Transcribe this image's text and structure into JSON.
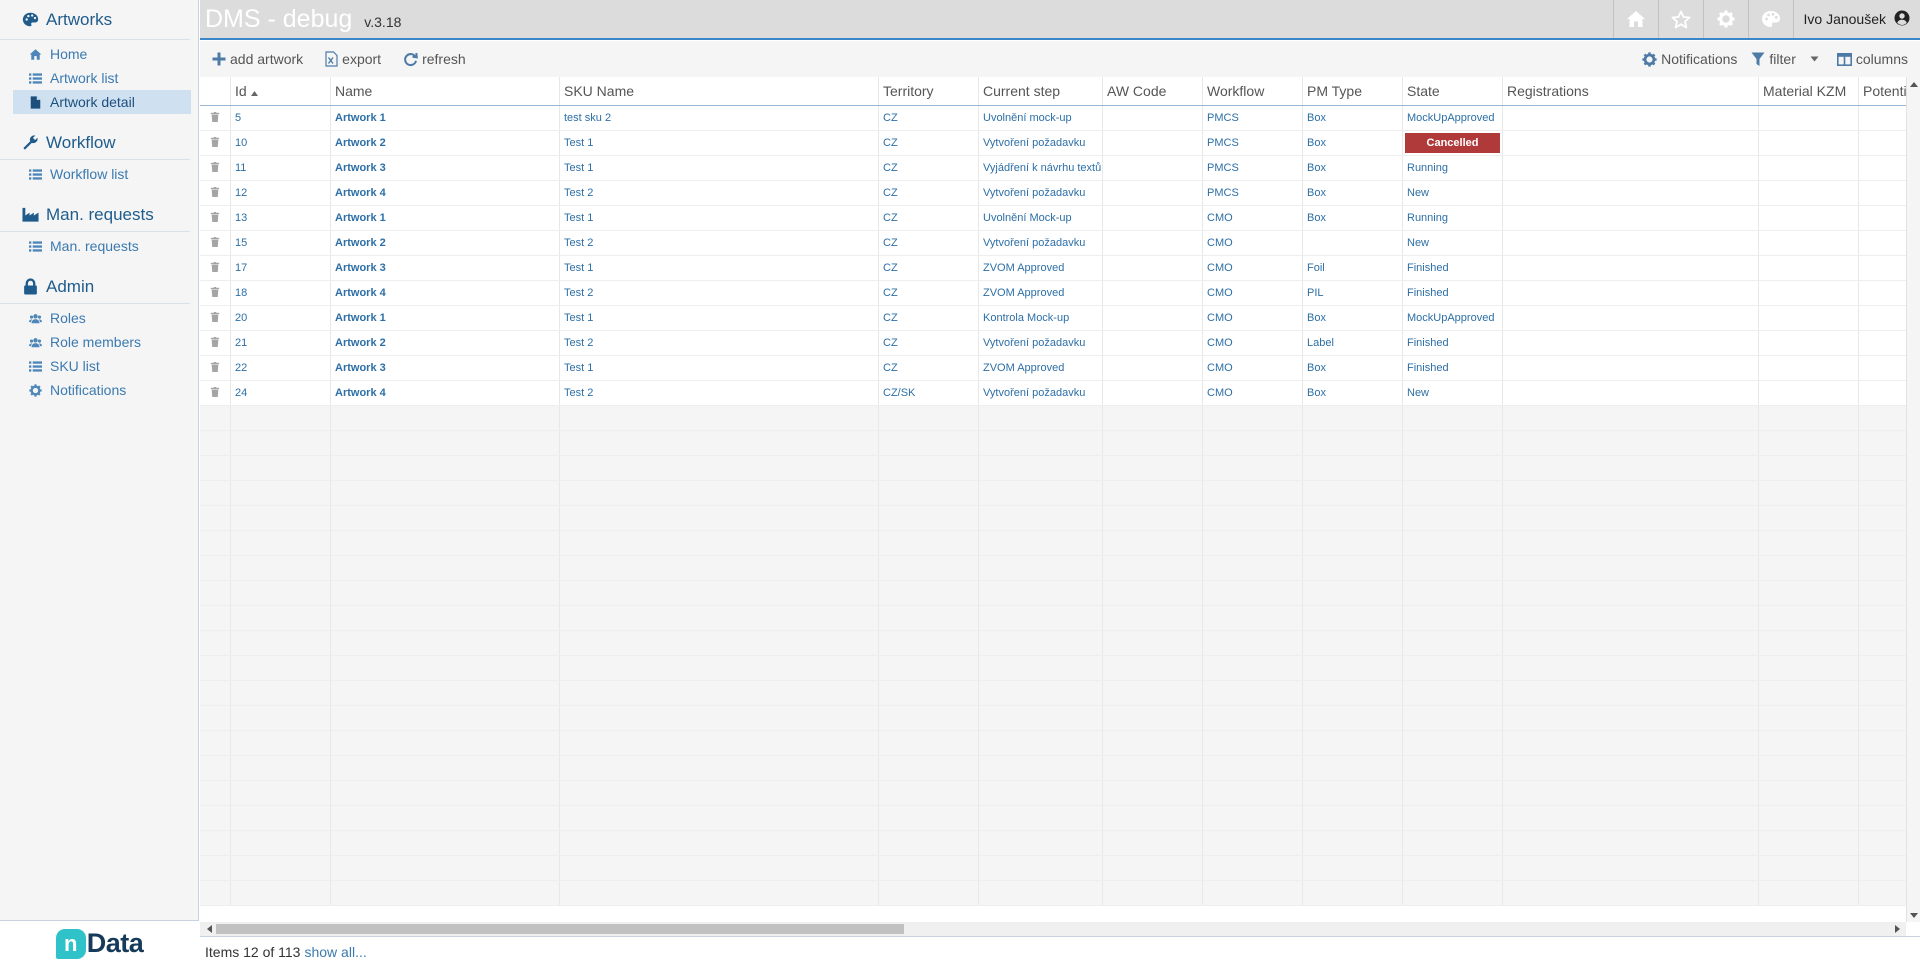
{
  "sidebar": {
    "sections": [
      {
        "title": "Artworks",
        "icon": "palette-icon",
        "items": [
          {
            "label": "Home",
            "icon": "home-icon",
            "active": false
          },
          {
            "label": "Artwork list",
            "icon": "list-icon",
            "active": false
          },
          {
            "label": "Artwork detail",
            "icon": "file-icon",
            "active": true
          }
        ]
      },
      {
        "title": "Workflow",
        "icon": "wrench-icon",
        "items": [
          {
            "label": "Workflow list",
            "icon": "list-icon",
            "active": false
          }
        ]
      },
      {
        "title": "Man. requests",
        "icon": "factory-icon",
        "items": [
          {
            "label": "Man. requests",
            "icon": "list-icon",
            "active": false
          }
        ]
      },
      {
        "title": "Admin",
        "icon": "lock-icon",
        "items": [
          {
            "label": "Roles",
            "icon": "users-icon",
            "active": false
          },
          {
            "label": "Role members",
            "icon": "users-icon",
            "active": false
          },
          {
            "label": "SKU list",
            "icon": "list-icon",
            "active": false
          },
          {
            "label": "Notifications",
            "icon": "gear-icon",
            "active": false
          }
        ]
      }
    ],
    "logo": {
      "n": "n",
      "text": "Data"
    }
  },
  "header": {
    "title": "DMS - debug",
    "version": "v.3.18",
    "icons": [
      "home-icon",
      "star-icon",
      "gear-icon",
      "palette-icon"
    ],
    "user": "Ivo Janoušek"
  },
  "toolbar": {
    "add": "add artwork",
    "export": "export",
    "refresh": "refresh",
    "notifications": "Notifications",
    "filter": "filter",
    "columns": "columns"
  },
  "grid": {
    "columns": [
      "",
      "Id",
      "Name",
      "SKU Name",
      "Territory",
      "Current step",
      "AW Code",
      "Workflow",
      "PM Type",
      "State",
      "Registrations",
      "Material KZM",
      "Potenti"
    ],
    "sort": {
      "column": "Id",
      "direction": "asc"
    },
    "rows": [
      {
        "id": "5",
        "name": "Artwork 1",
        "sku": "test sku 2",
        "territory": "CZ",
        "step": "Uvolnění mock-up",
        "aw": "",
        "workflow": "PMCS",
        "pm": "Box",
        "state": "MockUpApproved"
      },
      {
        "id": "10",
        "name": "Artwork 2",
        "sku": "Test 1",
        "territory": "CZ",
        "step": "Vytvoření požadavku",
        "aw": "",
        "workflow": "PMCS",
        "pm": "Box",
        "state": "Cancelled",
        "badge": true
      },
      {
        "id": "11",
        "name": "Artwork 3",
        "sku": "Test 1",
        "territory": "CZ",
        "step": "Vyjádření k návrhu textů",
        "aw": "",
        "workflow": "PMCS",
        "pm": "Box",
        "state": "Running"
      },
      {
        "id": "12",
        "name": "Artwork 4",
        "sku": "Test 2",
        "territory": "CZ",
        "step": "Vytvoření požadavku",
        "aw": "",
        "workflow": "PMCS",
        "pm": "Box",
        "state": "New"
      },
      {
        "id": "13",
        "name": "Artwork 1",
        "sku": "Test 1",
        "territory": "CZ",
        "step": "Uvolnění Mock-up",
        "aw": "",
        "workflow": "CMO",
        "pm": "Box",
        "state": "Running"
      },
      {
        "id": "15",
        "name": "Artwork 2",
        "sku": "Test 2",
        "territory": "CZ",
        "step": "Vytvoření požadavku",
        "aw": "",
        "workflow": "CMO",
        "pm": "",
        "state": "New"
      },
      {
        "id": "17",
        "name": "Artwork 3",
        "sku": "Test 1",
        "territory": "CZ",
        "step": "ZVOM Approved",
        "aw": "",
        "workflow": "CMO",
        "pm": "Foil",
        "state": "Finished"
      },
      {
        "id": "18",
        "name": "Artwork 4",
        "sku": "Test 2",
        "territory": "CZ",
        "step": "ZVOM Approved",
        "aw": "",
        "workflow": "CMO",
        "pm": "PIL",
        "state": "Finished"
      },
      {
        "id": "20",
        "name": "Artwork 1",
        "sku": "Test 1",
        "territory": "CZ",
        "step": "Kontrola Mock-up",
        "aw": "",
        "workflow": "CMO",
        "pm": "Box",
        "state": "MockUpApproved"
      },
      {
        "id": "21",
        "name": "Artwork 2",
        "sku": "Test 2",
        "territory": "CZ",
        "step": "Vytvoření požadavku",
        "aw": "",
        "workflow": "CMO",
        "pm": "Label",
        "state": "Finished"
      },
      {
        "id": "22",
        "name": "Artwork 3",
        "sku": "Test 1",
        "territory": "CZ",
        "step": "ZVOM Approved",
        "aw": "",
        "workflow": "CMO",
        "pm": "Box",
        "state": "Finished"
      },
      {
        "id": "24",
        "name": "Artwork 4",
        "sku": "Test 2",
        "territory": "CZ/SK",
        "step": "Vytvoření požadavku",
        "aw": "",
        "workflow": "CMO",
        "pm": "Box",
        "state": "New"
      }
    ]
  },
  "colors": {
    "accent": "#3a86c8",
    "link": "#2d6fa6",
    "cancelled": "#b03a3a"
  },
  "footer": {
    "items_label": "Items",
    "count": "12 of 113",
    "show_all": "show all..."
  }
}
